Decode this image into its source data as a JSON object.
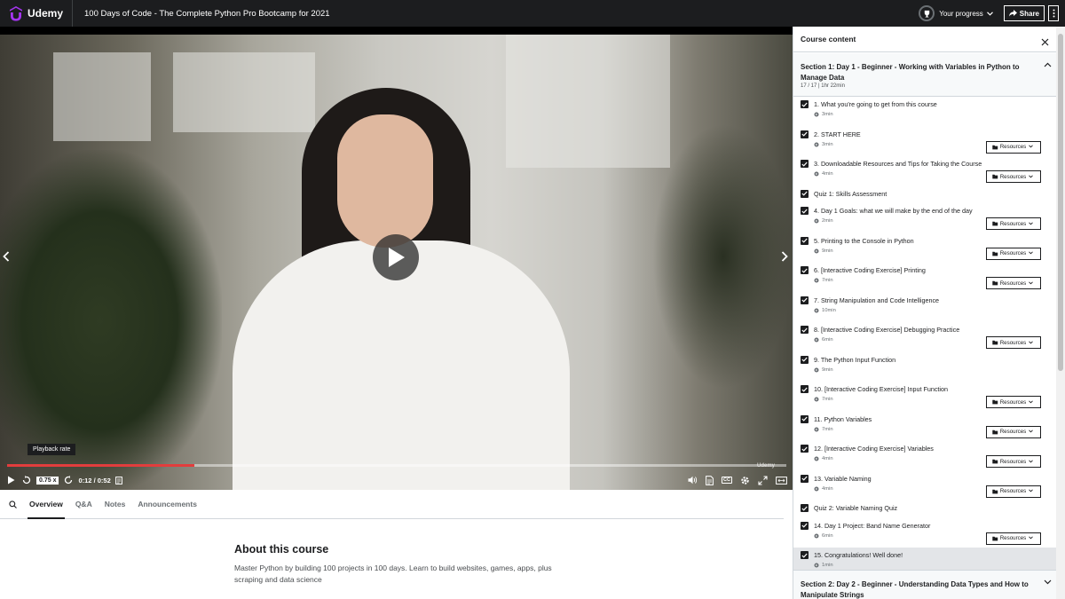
{
  "header": {
    "logo_text": "Udemy",
    "course_title": "100 Days of Code - The Complete Python Pro Bootcamp for 2021",
    "progress_label": "Your progress",
    "share_label": "Share"
  },
  "player": {
    "tooltip": "Playback rate",
    "playback_rate": "0.75 x",
    "time": "0:12 / 0:52",
    "progress_fraction": 0.24,
    "watermark": "Udemy"
  },
  "tabs": [
    {
      "label": "Overview"
    },
    {
      "label": "Q&A"
    },
    {
      "label": "Notes"
    },
    {
      "label": "Announcements"
    }
  ],
  "about": {
    "title": "About this course",
    "description": "Master Python by building 100 projects in 100 days. Learn to build websites, games, apps, plus scraping and data science"
  },
  "sidebar": {
    "title": "Course content",
    "sections": [
      {
        "title": "Section 1: Day 1 - Beginner - Working with Variables in Python to Manage Data",
        "meta": "17 / 17 | 1hr 22min"
      },
      {
        "title": "Section 2: Day 2 - Beginner - Understanding Data Types and How to Manipulate Strings",
        "meta": ""
      }
    ],
    "resources_label": "Resources",
    "lectures": [
      {
        "title": "1. What you're going to get from this course",
        "duration": "3min",
        "resources": false
      },
      {
        "title": "2. START HERE",
        "duration": "3min",
        "resources": true
      },
      {
        "title": "3. Downloadable Resources and Tips for Taking the Course",
        "duration": "4min",
        "resources": true
      },
      {
        "title": "Quiz 1: Skills Assessment",
        "duration": "",
        "resources": false
      },
      {
        "title": "4. Day 1 Goals: what we will make by the end of the day",
        "duration": "2min",
        "resources": true
      },
      {
        "title": "5. Printing to the Console in Python",
        "duration": "9min",
        "resources": true
      },
      {
        "title": "6. [Interactive Coding Exercise] Printing",
        "duration": "7min",
        "resources": true
      },
      {
        "title": "7. String Manipulation and Code Intelligence",
        "duration": "10min",
        "resources": false
      },
      {
        "title": "8. [Interactive Coding Exercise] Debugging Practice",
        "duration": "6min",
        "resources": true
      },
      {
        "title": "9. The Python Input Function",
        "duration": "9min",
        "resources": false
      },
      {
        "title": "10. [Interactive Coding Exercise] Input Function",
        "duration": "7min",
        "resources": true
      },
      {
        "title": "11. Python Variables",
        "duration": "7min",
        "resources": true
      },
      {
        "title": "12. [Interactive Coding Exercise] Variables",
        "duration": "4min",
        "resources": true
      },
      {
        "title": "13. Variable Naming",
        "duration": "4min",
        "resources": true
      },
      {
        "title": "Quiz 2: Variable Naming Quiz",
        "duration": "",
        "resources": false
      },
      {
        "title": "14. Day 1 Project: Band Name Generator",
        "duration": "6min",
        "resources": true
      },
      {
        "title": "15. Congratulations! Well done!",
        "duration": "1min",
        "resources": false,
        "current": true
      }
    ]
  },
  "colors": {
    "header_bg": "#1c1d1f",
    "logo_accent": "#a435f0",
    "scrubber": "#e23d3d",
    "current_row": "#e3e5e8"
  }
}
